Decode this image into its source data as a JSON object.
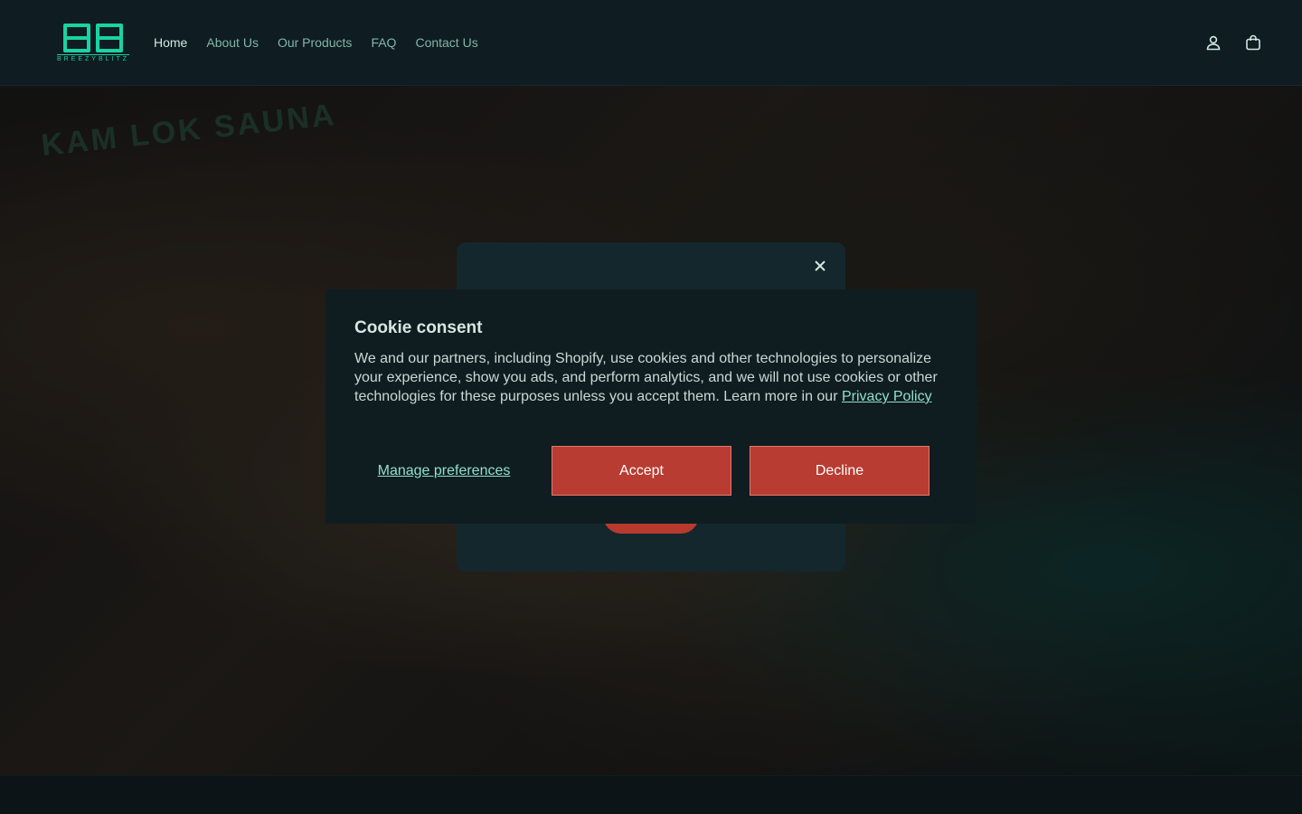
{
  "brand": {
    "name": "BREEZYBLITZ",
    "accent": "#19d3a4"
  },
  "nav": {
    "items": [
      {
        "label": "Home",
        "active": true
      },
      {
        "label": "About Us"
      },
      {
        "label": "Our Products"
      },
      {
        "label": "FAQ"
      },
      {
        "label": "Contact Us"
      }
    ]
  },
  "header_icons": [
    "account-icon",
    "cart-icon"
  ],
  "hero": {
    "sign_text": "KAM LOK SAUNA"
  },
  "modal": {
    "close_icon": "close-icon"
  },
  "cookie": {
    "title": "Cookie consent",
    "body": "We and our partners, including Shopify, use cookies and other technologies to personalize your experience, show you ads, and perform analytics, and we will not use cookies or other technologies for these purposes unless you accept them. Learn more in our ",
    "privacy_link": "Privacy Policy",
    "manage_label": "Manage preferences",
    "accept_label": "Accept",
    "decline_label": "Decline",
    "button_color": "#b83c31"
  }
}
